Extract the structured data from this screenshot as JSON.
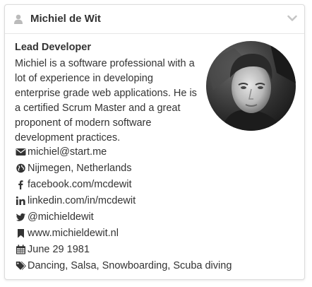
{
  "header": {
    "name": "Michiel de Wit",
    "user_icon": "user-icon",
    "toggle_icon": "chevron-down-icon"
  },
  "profile": {
    "role": "Lead Developer",
    "bio": "Michiel is a software professional with a lot of experience in developing enterprise grade web applications. He is a certified Scrum Master and a great proponent of modern software development practices.",
    "avatar": "profile-photo"
  },
  "contacts": [
    {
      "icon": "envelope-icon",
      "text": "michiel@start.me"
    },
    {
      "icon": "globe-icon",
      "text": "Nijmegen, Netherlands"
    },
    {
      "icon": "facebook-icon",
      "text": "facebook.com/mcdewit"
    },
    {
      "icon": "linkedin-icon",
      "text": "linkedin.com/in/mcdewit"
    },
    {
      "icon": "twitter-icon",
      "text": "@michieldewit"
    },
    {
      "icon": "bookmark-icon",
      "text": "www.michieldewit.nl"
    },
    {
      "icon": "calendar-icon",
      "text": "June 29 1981"
    },
    {
      "icon": "tags-icon",
      "text": "Dancing, Salsa, Snowboarding, Scuba diving"
    }
  ],
  "colors": {
    "text": "#333333",
    "icon": "#333333",
    "header_icon": "#bbbbbb",
    "border": "#dcdcdc"
  }
}
